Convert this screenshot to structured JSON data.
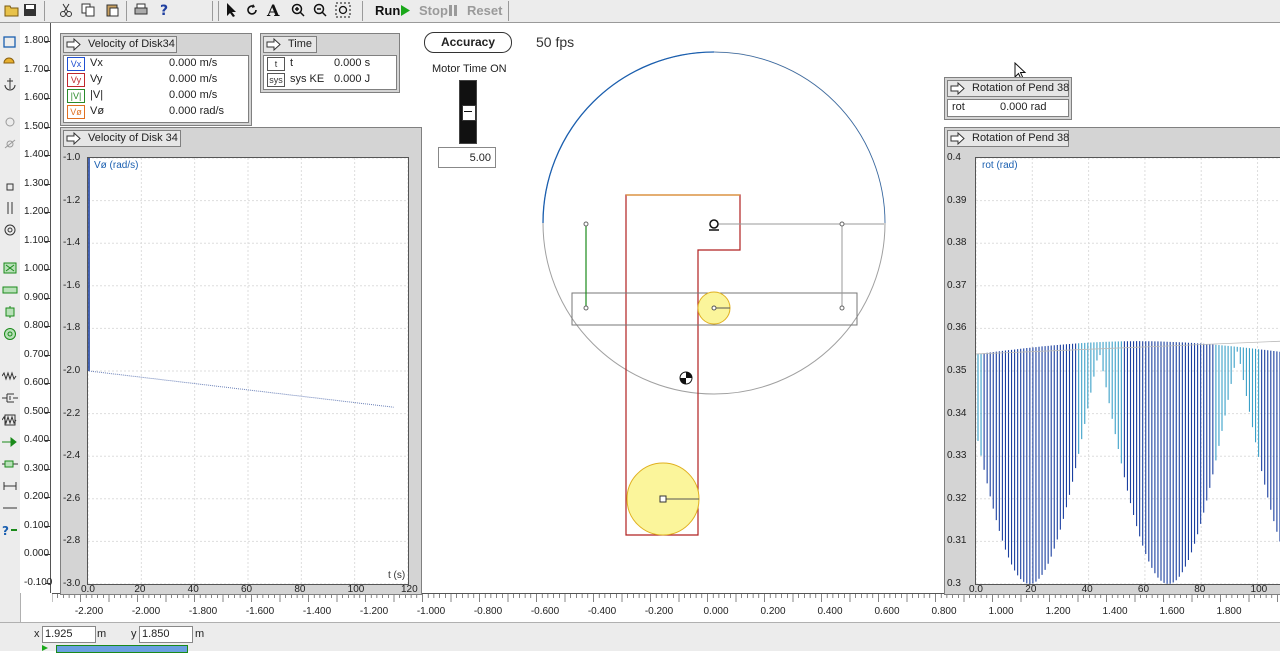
{
  "toolbar": {
    "run_label": "Run",
    "stop_label": "Stop",
    "reset_label": "Reset"
  },
  "fps": "50 fps",
  "accuracy_label": "Accuracy",
  "motor": {
    "label": "Motor Time ON",
    "value": "5.00"
  },
  "velocity_meter": {
    "title": "Velocity of Disk34",
    "rows": [
      {
        "tag": "Vx",
        "name": "Vx",
        "value": "0.000 m/s",
        "color": "#1f4fd1"
      },
      {
        "tag": "Vy",
        "name": "Vy",
        "value": "0.000 m/s",
        "color": "#c0282d"
      },
      {
        "tag": "|V|",
        "name": "|V|",
        "value": "0.000 m/s",
        "color": "#2a8a2a"
      },
      {
        "tag": "Vø",
        "name": "Vø",
        "value": "0.000 rad/s",
        "color": "#e07020"
      }
    ]
  },
  "time_meter": {
    "title": "Time",
    "t_tag": "t",
    "t_name": "t",
    "t_value": "0.000 s",
    "sys_tag": "sys",
    "sys_name": "sys KE",
    "sys_value": "0.000 J"
  },
  "rotation_meter": {
    "title": "Rotation of Pend 38",
    "name": "rot",
    "value": "0.000 rad"
  },
  "velocity_graph": {
    "title": "Velocity of Disk 34",
    "y_label": "Vø (rad/s)",
    "x_label": "t (s)",
    "y_ticks": [
      "-1.0",
      "-1.2",
      "-1.4",
      "-1.6",
      "-1.8",
      "-2.0",
      "-2.2",
      "-2.4",
      "-2.6",
      "-2.8",
      "-3.0"
    ],
    "x_ticks": [
      "0.0",
      "20",
      "40",
      "60",
      "80",
      "100",
      "120"
    ]
  },
  "rotation_graph": {
    "title": "Rotation of Pend 38",
    "y_label": "rot (rad)",
    "y_ticks": [
      "0.4",
      "0.39",
      "0.38",
      "0.37",
      "0.36",
      "0.35",
      "0.34",
      "0.33",
      "0.32",
      "0.31",
      "0.3"
    ],
    "x_ticks": [
      "0.0",
      "20",
      "40",
      "60",
      "80",
      "100"
    ]
  },
  "vruler_ticks": [
    "1.800",
    "1.700",
    "1.600",
    "1.500",
    "1.400",
    "1.300",
    "1.200",
    "1.100",
    "1.000",
    "0.900",
    "0.800",
    "0.700",
    "0.600",
    "0.500",
    "0.400",
    "0.300",
    "0.200",
    "0.100",
    "0.000",
    "-0.100"
  ],
  "hruler_ticks": [
    "-2.200",
    "-2.000",
    "-1.800",
    "-1.600",
    "-1.400",
    "-1.200",
    "-1.000",
    "-0.800",
    "-0.600",
    "-0.400",
    "-0.200",
    "0.000",
    "0.200",
    "0.400",
    "0.600",
    "0.800",
    "1.000",
    "1.200",
    "1.400",
    "1.600",
    "1.800",
    "2."
  ],
  "status": {
    "x_label": "x",
    "x_value": "1.925",
    "x_unit": "m",
    "y_label": "y",
    "y_value": "1.850",
    "y_unit": "m"
  }
}
